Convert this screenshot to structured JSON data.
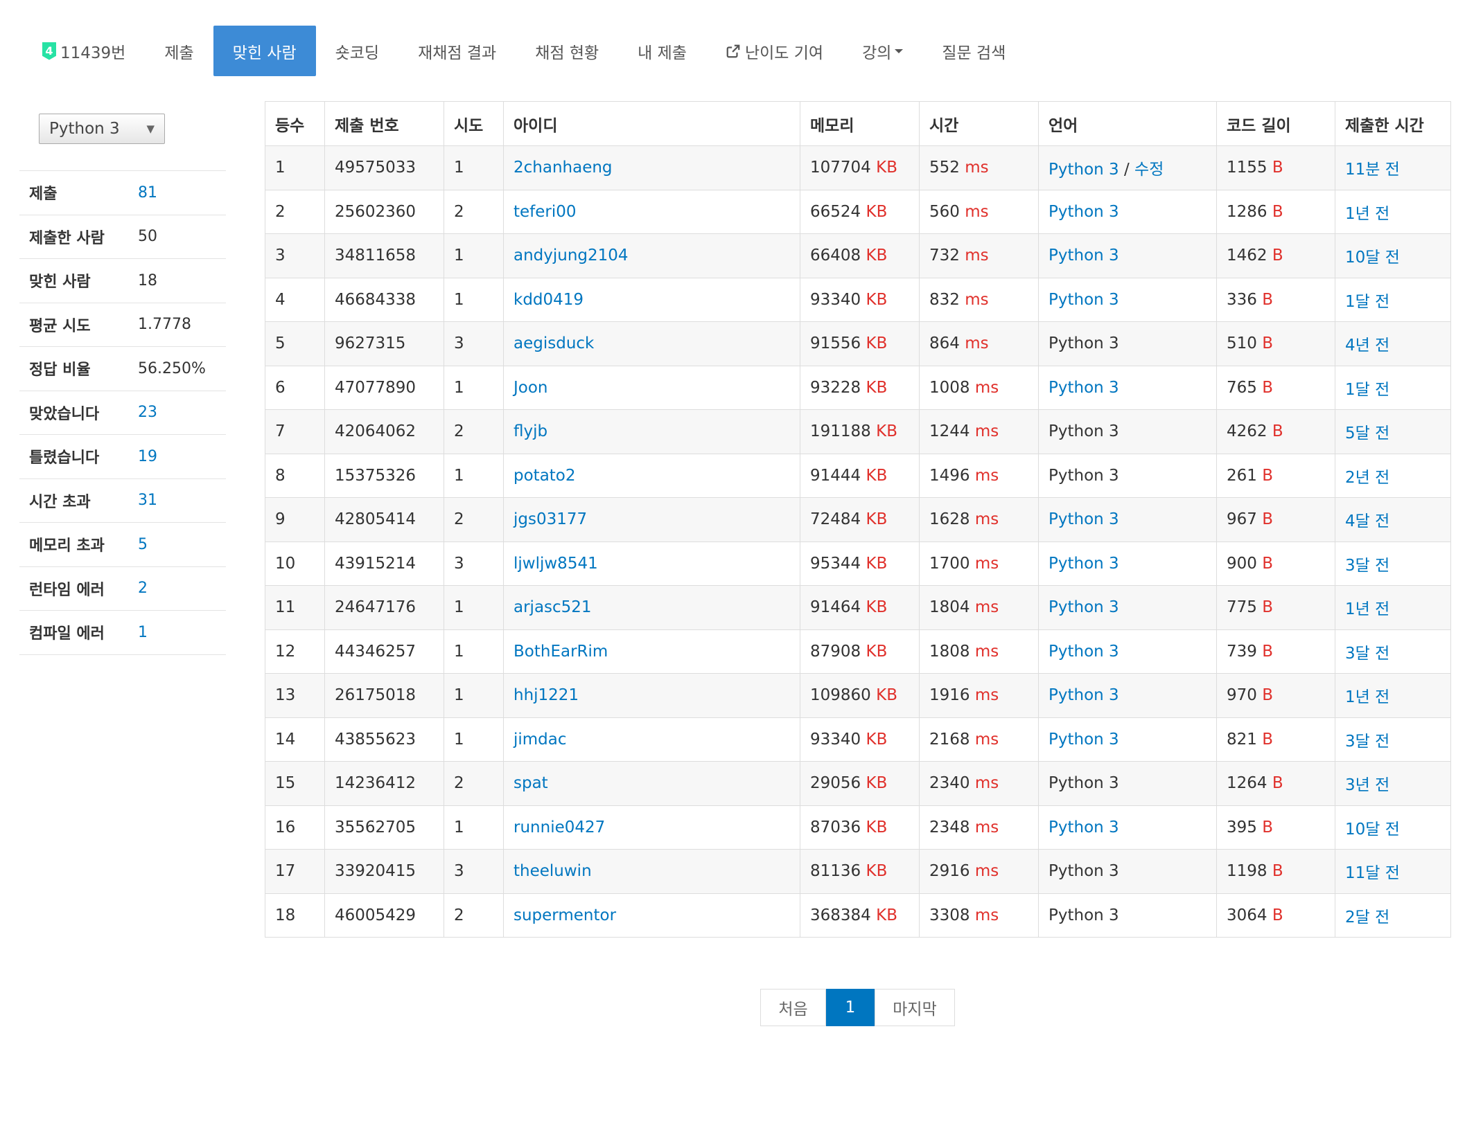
{
  "nav": {
    "tier_badge": "4",
    "problem": "11439번",
    "items": [
      "제출",
      "맞힌 사람",
      "숏코딩",
      "재채점 결과",
      "채점 현황",
      "내 제출",
      "난이도 기여",
      "강의",
      "질문 검색"
    ],
    "active": "맞힌 사람"
  },
  "filter": {
    "language": "Python 3"
  },
  "stats": [
    {
      "label": "제출",
      "value": "81"
    },
    {
      "label": "제출한 사람",
      "value": "50"
    },
    {
      "label": "맞힌 사람",
      "value": "18"
    },
    {
      "label": "평균 시도",
      "value": "1.7778"
    },
    {
      "label": "정답 비율",
      "value": "56.250%"
    },
    {
      "label": "맞았습니다",
      "value": "23"
    },
    {
      "label": "틀렸습니다",
      "value": "19"
    },
    {
      "label": "시간 초과",
      "value": "31"
    },
    {
      "label": "메모리 초과",
      "value": "5"
    },
    {
      "label": "런타임 에러",
      "value": "2"
    },
    {
      "label": "컴파일 에러",
      "value": "1"
    }
  ],
  "table": {
    "headers": [
      "등수",
      "제출 번호",
      "시도",
      "아이디",
      "메모리",
      "시간",
      "언어",
      "코드 길이",
      "제출한 시간"
    ],
    "units": {
      "memory": "KB",
      "time": "ms",
      "length": "B"
    },
    "edit_label": "수정",
    "rows": [
      {
        "rank": "1",
        "submission": "49575033",
        "tries": "1",
        "user": "2chanhaeng",
        "memory": "107704",
        "time": "552",
        "lang": "Python 3",
        "lang_link": true,
        "editable": true,
        "length": "1155",
        "submitted": "11분 전"
      },
      {
        "rank": "2",
        "submission": "25602360",
        "tries": "2",
        "user": "teferi00",
        "memory": "66524",
        "time": "560",
        "lang": "Python 3",
        "lang_link": true,
        "length": "1286",
        "submitted": "1년 전"
      },
      {
        "rank": "3",
        "submission": "34811658",
        "tries": "1",
        "user": "andyjung2104",
        "memory": "66408",
        "time": "732",
        "lang": "Python 3",
        "lang_link": true,
        "length": "1462",
        "submitted": "10달 전"
      },
      {
        "rank": "4",
        "submission": "46684338",
        "tries": "1",
        "user": "kdd0419",
        "memory": "93340",
        "time": "832",
        "lang": "Python 3",
        "lang_link": true,
        "length": "336",
        "submitted": "1달 전"
      },
      {
        "rank": "5",
        "submission": "9627315",
        "tries": "3",
        "user": "aegisduck",
        "memory": "91556",
        "time": "864",
        "lang": "Python 3",
        "lang_link": false,
        "length": "510",
        "submitted": "4년 전"
      },
      {
        "rank": "6",
        "submission": "47077890",
        "tries": "1",
        "user": "Joon",
        "memory": "93228",
        "time": "1008",
        "lang": "Python 3",
        "lang_link": true,
        "length": "765",
        "submitted": "1달 전"
      },
      {
        "rank": "7",
        "submission": "42064062",
        "tries": "2",
        "user": "flyjb",
        "memory": "191188",
        "time": "1244",
        "lang": "Python 3",
        "lang_link": false,
        "length": "4262",
        "submitted": "5달 전"
      },
      {
        "rank": "8",
        "submission": "15375326",
        "tries": "1",
        "user": "potato2",
        "memory": "91444",
        "time": "1496",
        "lang": "Python 3",
        "lang_link": false,
        "length": "261",
        "submitted": "2년 전"
      },
      {
        "rank": "9",
        "submission": "42805414",
        "tries": "2",
        "user": "jgs03177",
        "memory": "72484",
        "time": "1628",
        "lang": "Python 3",
        "lang_link": true,
        "length": "967",
        "submitted": "4달 전"
      },
      {
        "rank": "10",
        "submission": "43915214",
        "tries": "3",
        "user": "ljwljw8541",
        "memory": "95344",
        "time": "1700",
        "lang": "Python 3",
        "lang_link": true,
        "length": "900",
        "submitted": "3달 전"
      },
      {
        "rank": "11",
        "submission": "24647176",
        "tries": "1",
        "user": "arjasc521",
        "memory": "91464",
        "time": "1804",
        "lang": "Python 3",
        "lang_link": true,
        "length": "775",
        "submitted": "1년 전"
      },
      {
        "rank": "12",
        "submission": "44346257",
        "tries": "1",
        "user": "BothEarRim",
        "memory": "87908",
        "time": "1808",
        "lang": "Python 3",
        "lang_link": true,
        "length": "739",
        "submitted": "3달 전"
      },
      {
        "rank": "13",
        "submission": "26175018",
        "tries": "1",
        "user": "hhj1221",
        "memory": "109860",
        "time": "1916",
        "lang": "Python 3",
        "lang_link": true,
        "length": "970",
        "submitted": "1년 전"
      },
      {
        "rank": "14",
        "submission": "43855623",
        "tries": "1",
        "user": "jimdac",
        "memory": "93340",
        "time": "2168",
        "lang": "Python 3",
        "lang_link": true,
        "length": "821",
        "submitted": "3달 전"
      },
      {
        "rank": "15",
        "submission": "14236412",
        "tries": "2",
        "user": "spat",
        "memory": "29056",
        "time": "2340",
        "lang": "Python 3",
        "lang_link": false,
        "length": "1264",
        "submitted": "3년 전"
      },
      {
        "rank": "16",
        "submission": "35562705",
        "tries": "1",
        "user": "runnie0427",
        "memory": "87036",
        "time": "2348",
        "lang": "Python 3",
        "lang_link": true,
        "length": "395",
        "submitted": "10달 전"
      },
      {
        "rank": "17",
        "submission": "33920415",
        "tries": "3",
        "user": "theeluwin",
        "memory": "81136",
        "time": "2916",
        "lang": "Python 3",
        "lang_link": false,
        "length": "1198",
        "submitted": "11달 전"
      },
      {
        "rank": "18",
        "submission": "46005429",
        "tries": "2",
        "user": "supermentor",
        "memory": "368384",
        "time": "3308",
        "lang": "Python 3",
        "lang_link": false,
        "length": "3064",
        "submitted": "2달 전"
      }
    ]
  },
  "pagination": {
    "first": "처음",
    "current": "1",
    "last": "마지막"
  },
  "colors": {
    "accent": "#0076c0",
    "active_tab": "#3d8bd6",
    "unit": "#e0302b",
    "tier": "#27e2a4"
  }
}
